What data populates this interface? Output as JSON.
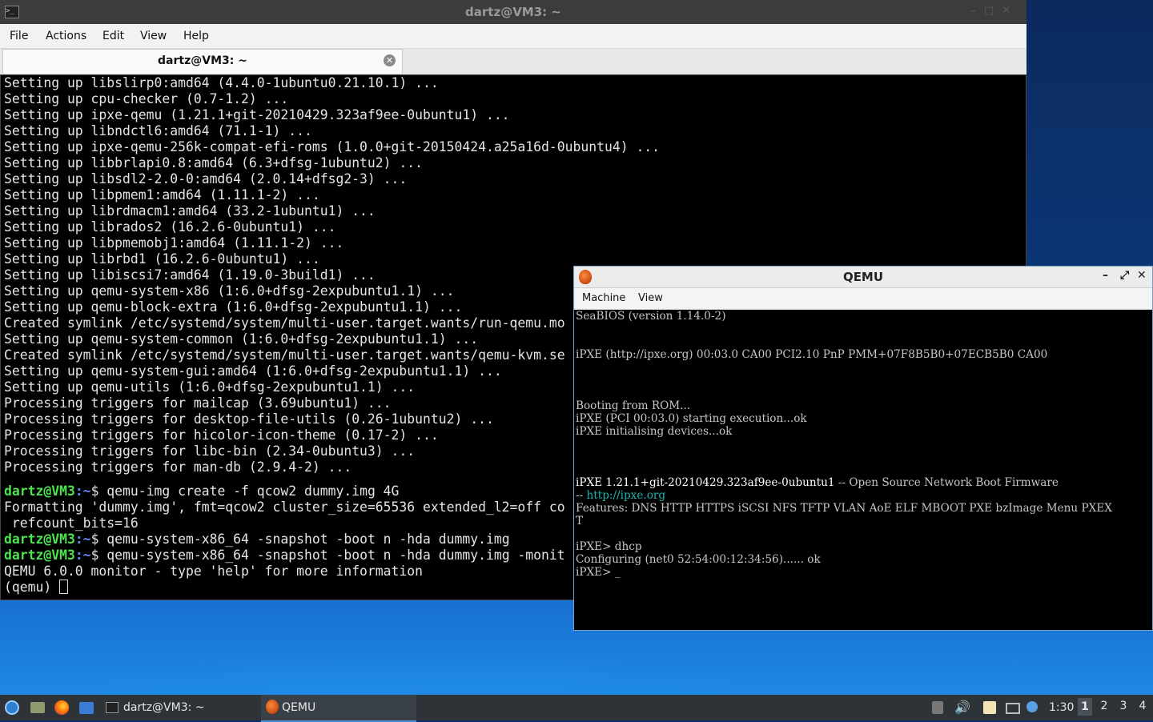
{
  "terminal": {
    "window_title": "dartz@VM3: ~",
    "menu": [
      "File",
      "Actions",
      "Edit",
      "View",
      "Help"
    ],
    "tab_label": "dartz@VM3: ~",
    "lines": [
      "Setting up libslirp0:amd64 (4.4.0-1ubuntu0.21.10.1) ...",
      "Setting up cpu-checker (0.7-1.2) ...",
      "Setting up ipxe-qemu (1.21.1+git-20210429.323af9ee-0ubuntu1) ...",
      "Setting up libndctl6:amd64 (71.1-1) ...",
      "Setting up ipxe-qemu-256k-compat-efi-roms (1.0.0+git-20150424.a25a16d-0ubuntu4) ...",
      "Setting up libbrlapi0.8:amd64 (6.3+dfsg-1ubuntu2) ...",
      "Setting up libsdl2-2.0-0:amd64 (2.0.14+dfsg2-3) ...",
      "Setting up libpmem1:amd64 (1.11.1-2) ...",
      "Setting up librdmacm1:amd64 (33.2-1ubuntu1) ...",
      "Setting up librados2 (16.2.6-0ubuntu1) ...",
      "Setting up libpmemobj1:amd64 (1.11.1-2) ...",
      "Setting up librbd1 (16.2.6-0ubuntu1) ...",
      "Setting up libiscsi7:amd64 (1.19.0-3build1) ...",
      "Setting up qemu-system-x86 (1:6.0+dfsg-2expubuntu1.1) ...",
      "Setting up qemu-block-extra (1:6.0+dfsg-2expubuntu1.1) ...",
      "Created symlink /etc/systemd/system/multi-user.target.wants/run-qemu.mo",
      "Setting up qemu-system-common (1:6.0+dfsg-2expubuntu1.1) ...",
      "Created symlink /etc/systemd/system/multi-user.target.wants/qemu-kvm.se",
      "Setting up qemu-system-gui:amd64 (1:6.0+dfsg-2expubuntu1.1) ...",
      "Setting up qemu-utils (1:6.0+dfsg-2expubuntu1.1) ...",
      "Processing triggers for mailcap (3.69ubuntu1) ...",
      "Processing triggers for desktop-file-utils (0.26-1ubuntu2) ...",
      "Processing triggers for hicolor-icon-theme (0.17-2) ...",
      "Processing triggers for libc-bin (2.34-0ubuntu3) ...",
      "Processing triggers for man-db (2.9.4-2) ..."
    ],
    "prompt_user": "dartz@VM3",
    "prompt_path": ":~",
    "cmd1": "$ qemu-img create -f qcow2 dummy.img 4G",
    "out1a": "Formatting 'dummy.img', fmt=qcow2 cluster_size=65536 extended_l2=off co",
    "out1b": " refcount_bits=16",
    "cmd2": "$ qemu-system-x86_64 -snapshot -boot n -hda dummy.img",
    "cmd3": "$ qemu-system-x86_64 -snapshot -boot n -hda dummy.img -monit",
    "out3": "QEMU 6.0.0 monitor - type 'help' for more information",
    "monitor_prompt": "(qemu) "
  },
  "qemu": {
    "window_title": "QEMU",
    "menu": [
      "Machine",
      "View"
    ],
    "screen": {
      "l1": "SeaBIOS (version 1.14.0-2)",
      "l2": "iPXE (http://ipxe.org) 00:03.0 CA00 PCI2.10 PnP PMM+07F8B5B0+07ECB5B0 CA00",
      "l3": "Booting from ROM...",
      "l4": "iPXE (PCI 00:03.0) starting execution...ok",
      "l5": "iPXE initialising devices...ok",
      "l6a": "iPXE 1.21.1+git-20210429.323af9ee-0ubuntu1",
      "l6b": " -- Open Source Network Boot Firmware",
      "l7a": "-- ",
      "l7b": "http://ipxe.org",
      "l8": "Features: DNS HTTP HTTPS iSCSI NFS TFTP VLAN AoE ELF MBOOT PXE bzImage Menu PXEX",
      "l9": "T",
      "l10": "iPXE> dhcp",
      "l11": "Configuring (net0 52:54:00:12:34:56)...... ok",
      "l12": "iPXE> _"
    }
  },
  "taskbar": {
    "tasks": [
      {
        "label": "dartz@VM3: ~",
        "icon": "terminal-icon"
      },
      {
        "label": "QEMU",
        "icon": "qemu-icon"
      }
    ],
    "clock": "1:30",
    "workspaces": [
      "1",
      "2",
      "3",
      "4"
    ],
    "active_workspace": "1"
  }
}
